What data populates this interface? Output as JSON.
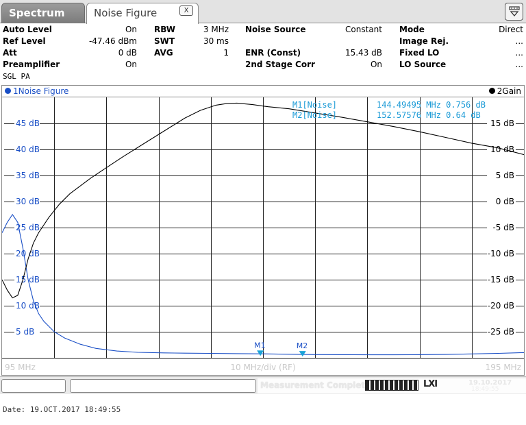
{
  "tabs": {
    "spectrum": "Spectrum",
    "noise_figure": "Noise Figure",
    "close": "X"
  },
  "settings": {
    "col1": [
      {
        "label": "Auto Level",
        "value": "On"
      },
      {
        "label": "Ref Level",
        "value": "-47.46 dBm"
      },
      {
        "label": "Att",
        "value": "0 dB"
      },
      {
        "label": "Preamplifier",
        "value": "On"
      }
    ],
    "col2": [
      {
        "label": "RBW",
        "value": "3 MHz"
      },
      {
        "label": "SWT",
        "value": "30 ms"
      },
      {
        "label": "AVG",
        "value": "1"
      }
    ],
    "col3": [
      {
        "label": "Noise Source",
        "value": "Constant"
      },
      {
        "label": "",
        "value": ""
      },
      {
        "label": "ENR (Const)",
        "value": "15.43 dB"
      },
      {
        "label": "2nd Stage Corr",
        "value": "On"
      }
    ],
    "col4": [
      {
        "label": "Mode",
        "value": "Direct"
      },
      {
        "label": "Image Rej.",
        "value": "..."
      },
      {
        "label": "Fixed LO",
        "value": "..."
      },
      {
        "label": "LO Source",
        "value": "..."
      }
    ],
    "sgl_pa": "SGL  PA"
  },
  "trace": {
    "trace1_label": "1Noise Figure",
    "trace2_label": "2Gain",
    "trace1_color": "#1a4fc6",
    "trace2_color": "#000000"
  },
  "markers": {
    "m1_label": "M1[Noise]",
    "m1_value": "144.49495 MHz 0.756 dB",
    "m2_label": "M2[Noise]",
    "m2_value": "152.57576 MHz 0.64 dB",
    "m1_tag": "M1",
    "m2_tag": "M2"
  },
  "chart_data": {
    "type": "line",
    "x_start_label": "95 MHz",
    "x_div_label": "10 MHz/div (RF)",
    "x_stop_label": "195 MHz",
    "xlim": [
      95,
      195
    ],
    "left_axis": {
      "ylim": [
        0,
        50
      ],
      "ticks": [
        "45 dB",
        "40 dB",
        "35 dB",
        "30 dB",
        "25 dB",
        "20 dB",
        "15 dB",
        "10 dB",
        "5 dB"
      ]
    },
    "right_axis": {
      "ylim": [
        -30,
        20
      ],
      "ticks": [
        "15 dB",
        "10 dB",
        "5 dB",
        "0 dB",
        "-5 dB",
        "-10 dB",
        "-15 dB",
        "-20 dB",
        "-25 dB"
      ]
    },
    "series": [
      {
        "name": "1Noise Figure",
        "axis": "left",
        "x": [
          95,
          96,
          97,
          98,
          99,
          100,
          101,
          102,
          103,
          105,
          107,
          110,
          113,
          117,
          121,
          126,
          130,
          135,
          140,
          145,
          150,
          155,
          160,
          165,
          170,
          175,
          180,
          185,
          190,
          195
        ],
        "y": [
          24,
          26,
          27.5,
          26,
          21,
          15,
          11,
          8.5,
          7,
          5,
          3.8,
          2.6,
          1.8,
          1.3,
          1.05,
          0.95,
          0.9,
          0.85,
          0.8,
          0.76,
          0.68,
          0.62,
          0.6,
          0.58,
          0.58,
          0.6,
          0.65,
          0.75,
          0.85,
          1.0
        ]
      },
      {
        "name": "2Gain",
        "axis": "right",
        "x": [
          95,
          96,
          97,
          98,
          99,
          100,
          101,
          102,
          104,
          106,
          108,
          110,
          112,
          115,
          118,
          122,
          126,
          130,
          133,
          136,
          138,
          140,
          143,
          146,
          150,
          155,
          160,
          165,
          170,
          175,
          180,
          185,
          190,
          195
        ],
        "y": [
          -15,
          -17,
          -18.5,
          -18,
          -15,
          -11,
          -8,
          -6,
          -3,
          -0.5,
          1.5,
          3,
          4.5,
          6.5,
          8.5,
          11,
          13.5,
          16,
          17.5,
          18.5,
          18.8,
          18.9,
          18.6,
          18.2,
          17.8,
          17,
          16.2,
          15.3,
          14.4,
          13.4,
          12.3,
          11.2,
          10.3,
          9.0
        ]
      }
    ]
  },
  "status": {
    "message": "Measurement Complete",
    "logo": "LXI",
    "date": "19.10.2017",
    "time": "18:49:55"
  },
  "footer": {
    "date_line": "Date: 19.OCT.2017  18:49:55"
  }
}
